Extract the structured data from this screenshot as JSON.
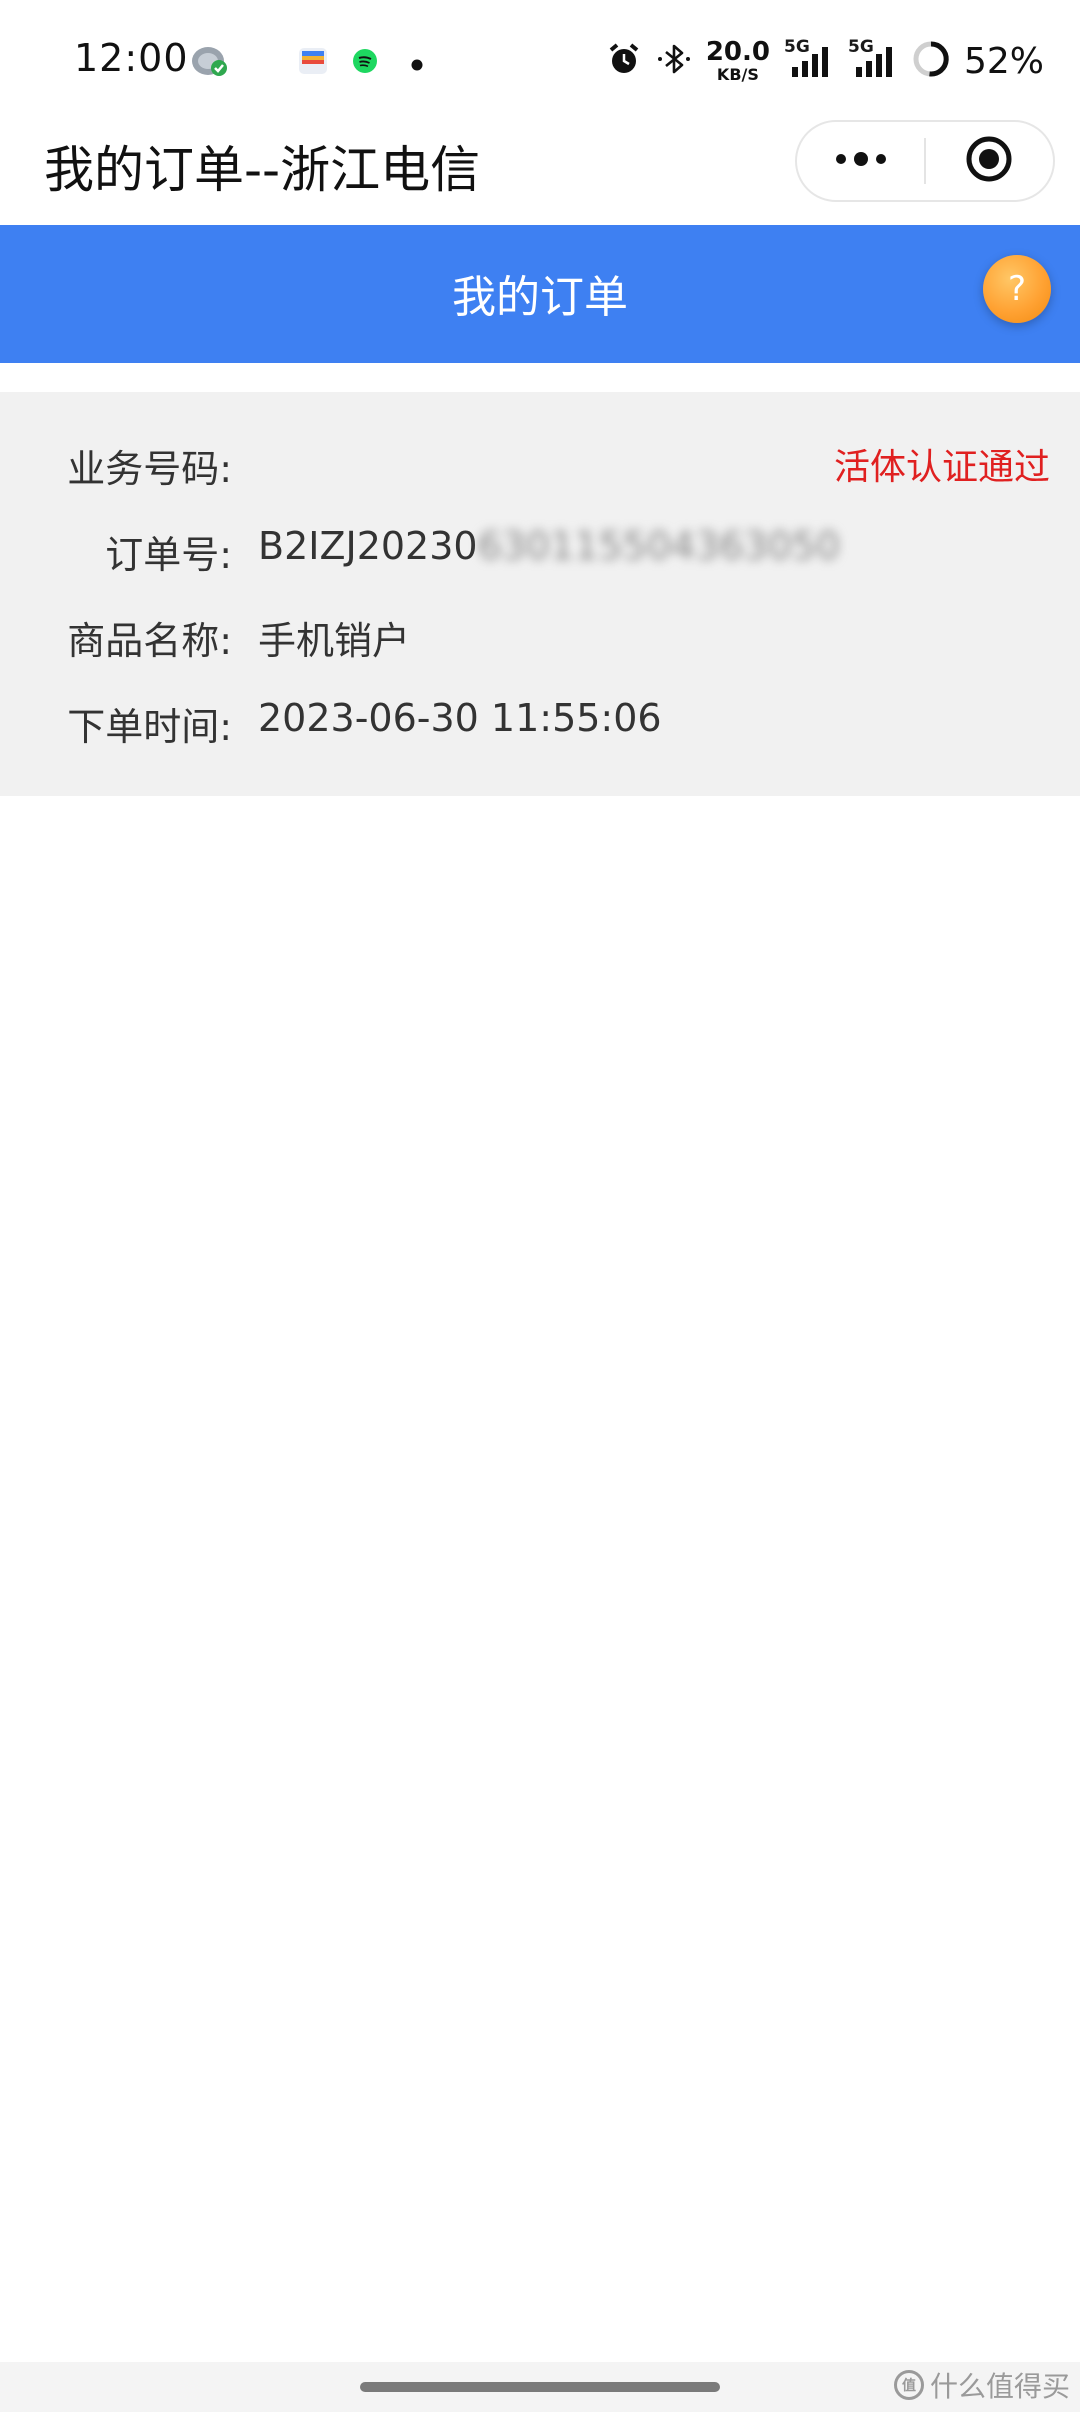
{
  "status_bar": {
    "time": "12:00",
    "net_speed_value": "20.0",
    "net_speed_unit": "KB/S",
    "signal_1_label": "5G",
    "signal_2_label": "5G",
    "battery": "52%",
    "icons": [
      "gallery-icon",
      "wallet-icon",
      "spotify-icon",
      "notification-dot-icon",
      "alarm-icon",
      "bluetooth-icon",
      "signal-icon",
      "battery-icon"
    ]
  },
  "title_bar": {
    "title": "我的订单--浙江电信",
    "more_icon": "more-dots-icon",
    "close_icon": "target-close-icon"
  },
  "header": {
    "title": "我的订单",
    "help_glyph": "?"
  },
  "order": {
    "status": "活体认证通过",
    "rows": [
      {
        "label": "业务号码:",
        "value": ""
      },
      {
        "label": "订单号:",
        "value_visible": "B2IZJ20230",
        "value_blurred": "630115504363050"
      },
      {
        "label": "商品名称:",
        "value": "手机销户"
      },
      {
        "label": "下单时间:",
        "value": "2023-06-30 11:55:06"
      }
    ]
  },
  "watermark": {
    "logo": "值",
    "text": "什么值得买"
  },
  "colors": {
    "header_blue": "#3e80f2",
    "status_red": "#e02020",
    "help_orange": "#ffa233",
    "card_gray": "#f1f1f1"
  }
}
